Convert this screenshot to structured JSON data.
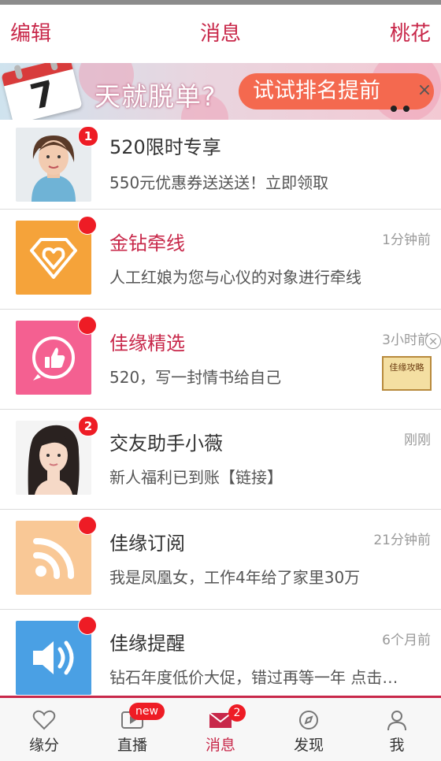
{
  "header": {
    "left": "编辑",
    "title": "消息",
    "right": "桃花"
  },
  "banner": {
    "calendar_number": "7",
    "slogan": "天就脱单?",
    "cta": "试试排名提前",
    "close": "×"
  },
  "messages": [
    {
      "title": "520限时专享",
      "subtitle": "550元优惠券送送送！立即领取",
      "time": "",
      "badge": "1",
      "avatar": "woman-portrait",
      "title_color": "#333333"
    },
    {
      "title": "金钻牵线",
      "subtitle": "人工红娘为您与心仪的对象进行牵线",
      "time": "1分钟前",
      "badge": "",
      "avatar": "diamond-heart-icon",
      "title_color": "#c8284a"
    },
    {
      "title": "佳缘精选",
      "subtitle": "520，写一封情书给自己",
      "time": "3小时前",
      "badge": "",
      "avatar": "thumbs-up-icon",
      "title_color": "#c8284a"
    },
    {
      "title": "交友助手小薇",
      "subtitle": "新人福利已到账【链接】",
      "time": "刚刚",
      "badge": "2",
      "avatar": "woman-portrait",
      "title_color": "#333333"
    },
    {
      "title": "佳缘订阅",
      "subtitle": "我是凤凰女，工作4年给了家里30万",
      "time": "21分钟前",
      "badge": "",
      "avatar": "rss-icon",
      "title_color": "#333333"
    },
    {
      "title": "佳缘提醒",
      "subtitle": "钻石年度低价大促，错过再等一年 点击…",
      "time": "6个月前",
      "badge": "",
      "avatar": "speaker-icon",
      "title_color": "#333333"
    }
  ],
  "ad": {
    "close": "×",
    "book_text": "佳缘攻略"
  },
  "tabs": [
    {
      "label": "缘分",
      "icon": "heart-icon",
      "active": false
    },
    {
      "label": "直播",
      "icon": "live-play-icon",
      "badge": "new",
      "active": false
    },
    {
      "label": "消息",
      "icon": "envelope-icon",
      "badge": "2",
      "active": true
    },
    {
      "label": "发现",
      "icon": "discover-icon",
      "active": false
    },
    {
      "label": "我",
      "icon": "profile-icon",
      "active": false
    }
  ],
  "colors": {
    "accent": "#c8284a",
    "badge": "#ee1c25",
    "text": "#333333",
    "muted": "#999999"
  }
}
